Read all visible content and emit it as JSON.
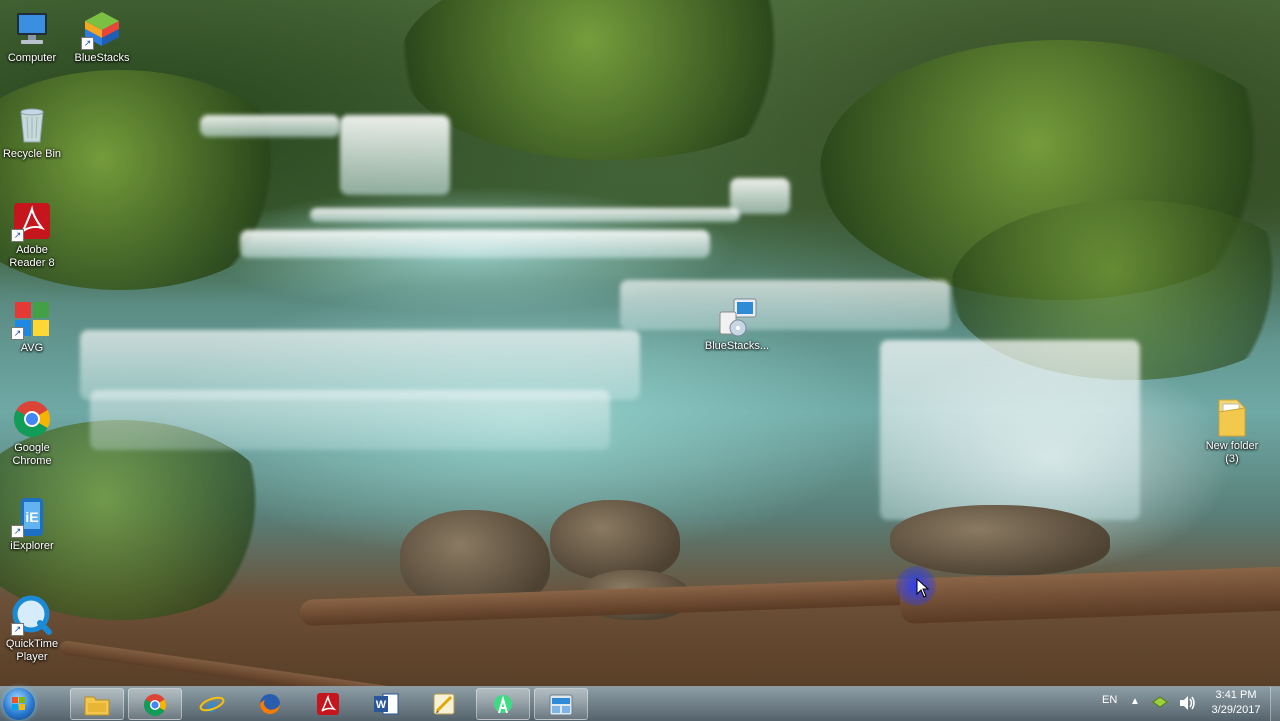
{
  "desktop": {
    "icons": [
      {
        "label": "Computer"
      },
      {
        "label": "BlueStacks"
      },
      {
        "label": "Recycle Bin"
      },
      {
        "label": "Adobe\nReader 8"
      },
      {
        "label": "AVG"
      },
      {
        "label": "Google\nChrome"
      },
      {
        "label": "iExplorer"
      },
      {
        "label": "QuickTime\nPlayer"
      },
      {
        "label": "BlueStacks..."
      },
      {
        "label": "New folder\n(3)"
      }
    ]
  },
  "taskbar": {
    "pinned": [
      "windows-explorer-icon",
      "chrome-icon",
      "internet-explorer-icon",
      "firefox-icon",
      "adobe-reader-icon",
      "word-icon",
      "sketch-icon",
      "android-studio-icon",
      "bluestacks-installer-icon"
    ],
    "language": "EN",
    "time": "3:41 PM",
    "date": "3/29/2017"
  }
}
